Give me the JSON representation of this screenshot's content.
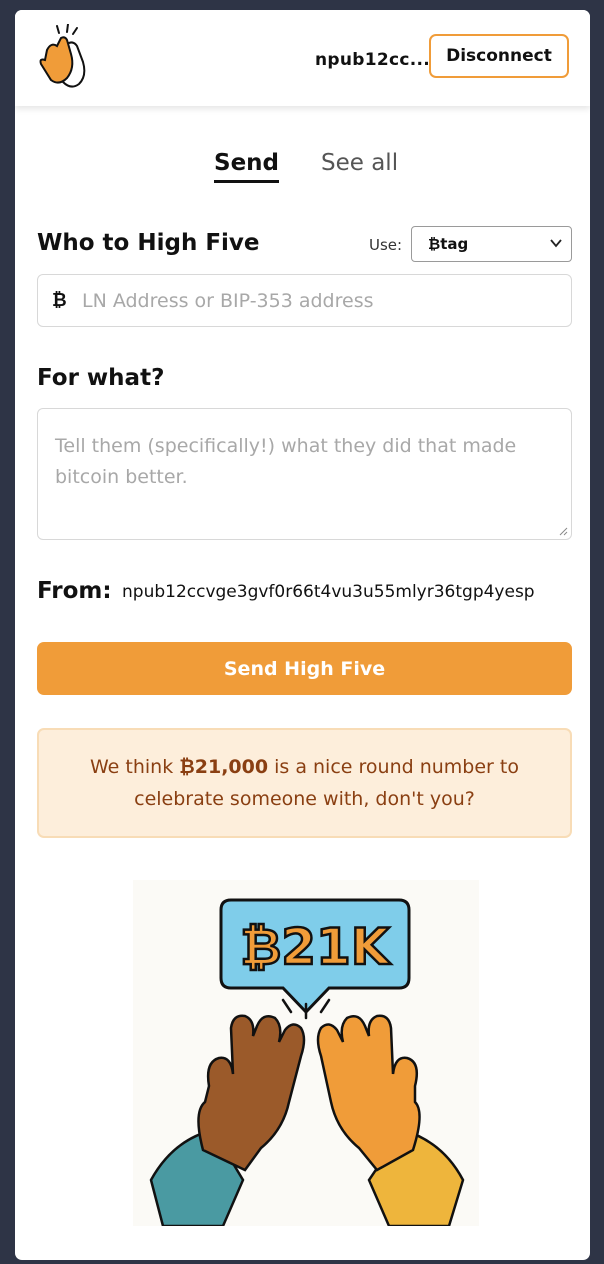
{
  "header": {
    "npub_short": "npub12cc...",
    "disconnect_label": "Disconnect"
  },
  "tabs": [
    {
      "label": "Send",
      "active": true
    },
    {
      "label": "See all",
      "active": false
    }
  ],
  "recipient": {
    "heading": "Who to High Five",
    "use_label": "Use:",
    "use_selected": "₿tag",
    "prefix_symbol": "₿",
    "placeholder": "LN Address or BIP-353 address"
  },
  "reason": {
    "heading": "For what?",
    "placeholder": "Tell them (specifically!) what they did that made bitcoin better."
  },
  "from": {
    "label": "From:",
    "value": "npub12ccvge3gvf0r66t4vu3u55mlyr36tgp4yesp"
  },
  "send_button_label": "Send High Five",
  "notice": {
    "before": "We think ",
    "amount": "₿21,000",
    "after": " is a nice round number to celebrate someone with, don't you?"
  },
  "illustration": {
    "bubble_text": "₿21K"
  },
  "colors": {
    "accent": "#f09c39",
    "background": "#2e3446",
    "notice_bg": "#fdeedb",
    "notice_text": "#8a3f12"
  }
}
